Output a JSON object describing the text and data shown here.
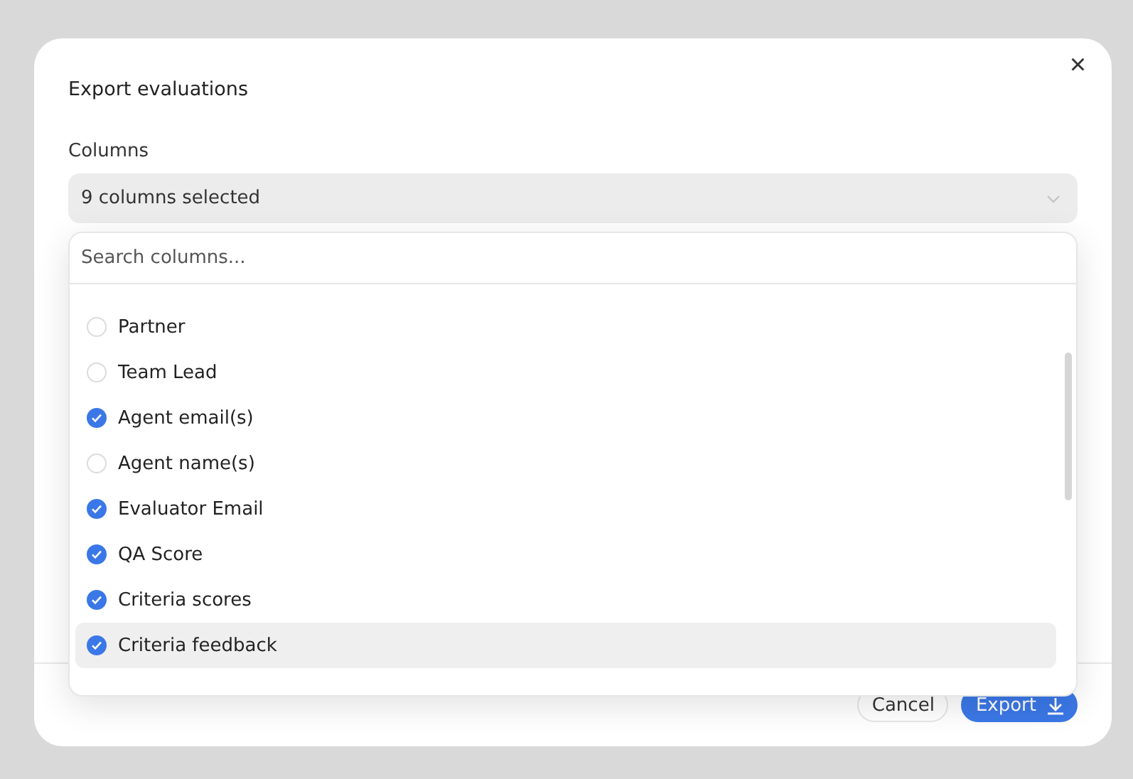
{
  "dialog": {
    "title": "Export evaluations",
    "close_label": "×"
  },
  "columns_field": {
    "label": "Columns",
    "value": "9 columns selected"
  },
  "dropdown": {
    "search": {
      "placeholder": "Search columns..."
    },
    "items": [
      {
        "label": "Partner",
        "checked": false,
        "selected": false
      },
      {
        "label": "Team Lead",
        "checked": false,
        "selected": false
      },
      {
        "label": "Agent email(s)",
        "checked": true,
        "selected": false
      },
      {
        "label": "Agent name(s)",
        "checked": false,
        "selected": false
      },
      {
        "label": "Evaluator Email",
        "checked": true,
        "selected": false
      },
      {
        "label": "QA Score",
        "checked": true,
        "selected": false
      },
      {
        "label": "Criteria scores",
        "checked": true,
        "selected": false
      },
      {
        "label": "Criteria feedback",
        "checked": true,
        "selected": true
      }
    ]
  },
  "buttons": {
    "cancel": "Cancel",
    "export": "Export"
  }
}
